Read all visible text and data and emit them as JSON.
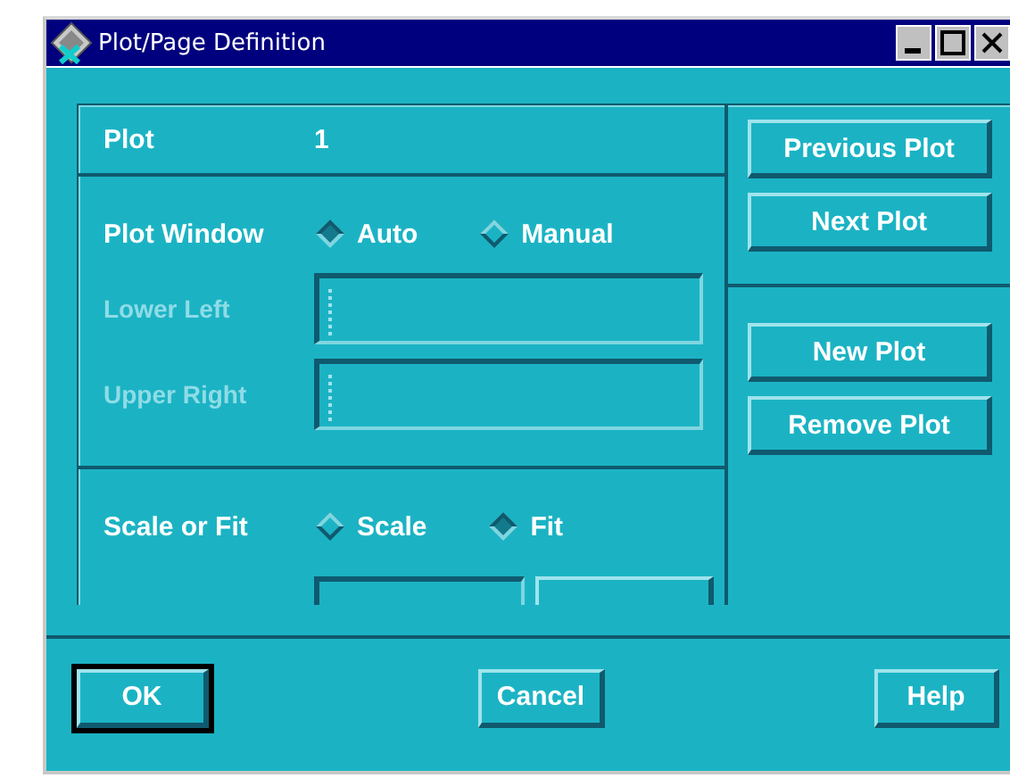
{
  "window": {
    "title": "Plot/Page Definition"
  },
  "plot": {
    "label": "Plot",
    "value": "1"
  },
  "plot_window": {
    "label": "Plot Window",
    "options": [
      {
        "label": "Auto",
        "selected": true
      },
      {
        "label": "Manual",
        "selected": false
      }
    ],
    "fields": [
      {
        "label": "Lower Left",
        "disabled": true
      },
      {
        "label": "Upper Right",
        "disabled": true
      }
    ]
  },
  "scale_or_fit": {
    "label": "Scale or Fit",
    "options": [
      {
        "label": "Scale",
        "selected": false
      },
      {
        "label": "Fit",
        "selected": true
      }
    ]
  },
  "side_buttons": [
    [
      "Previous Plot",
      "Next Plot"
    ],
    [
      "New Plot",
      "Remove Plot"
    ]
  ],
  "buttons": [
    {
      "label": "OK",
      "default": true
    },
    {
      "label": "Cancel",
      "default": false
    },
    {
      "label": "Help",
      "default": false
    }
  ]
}
